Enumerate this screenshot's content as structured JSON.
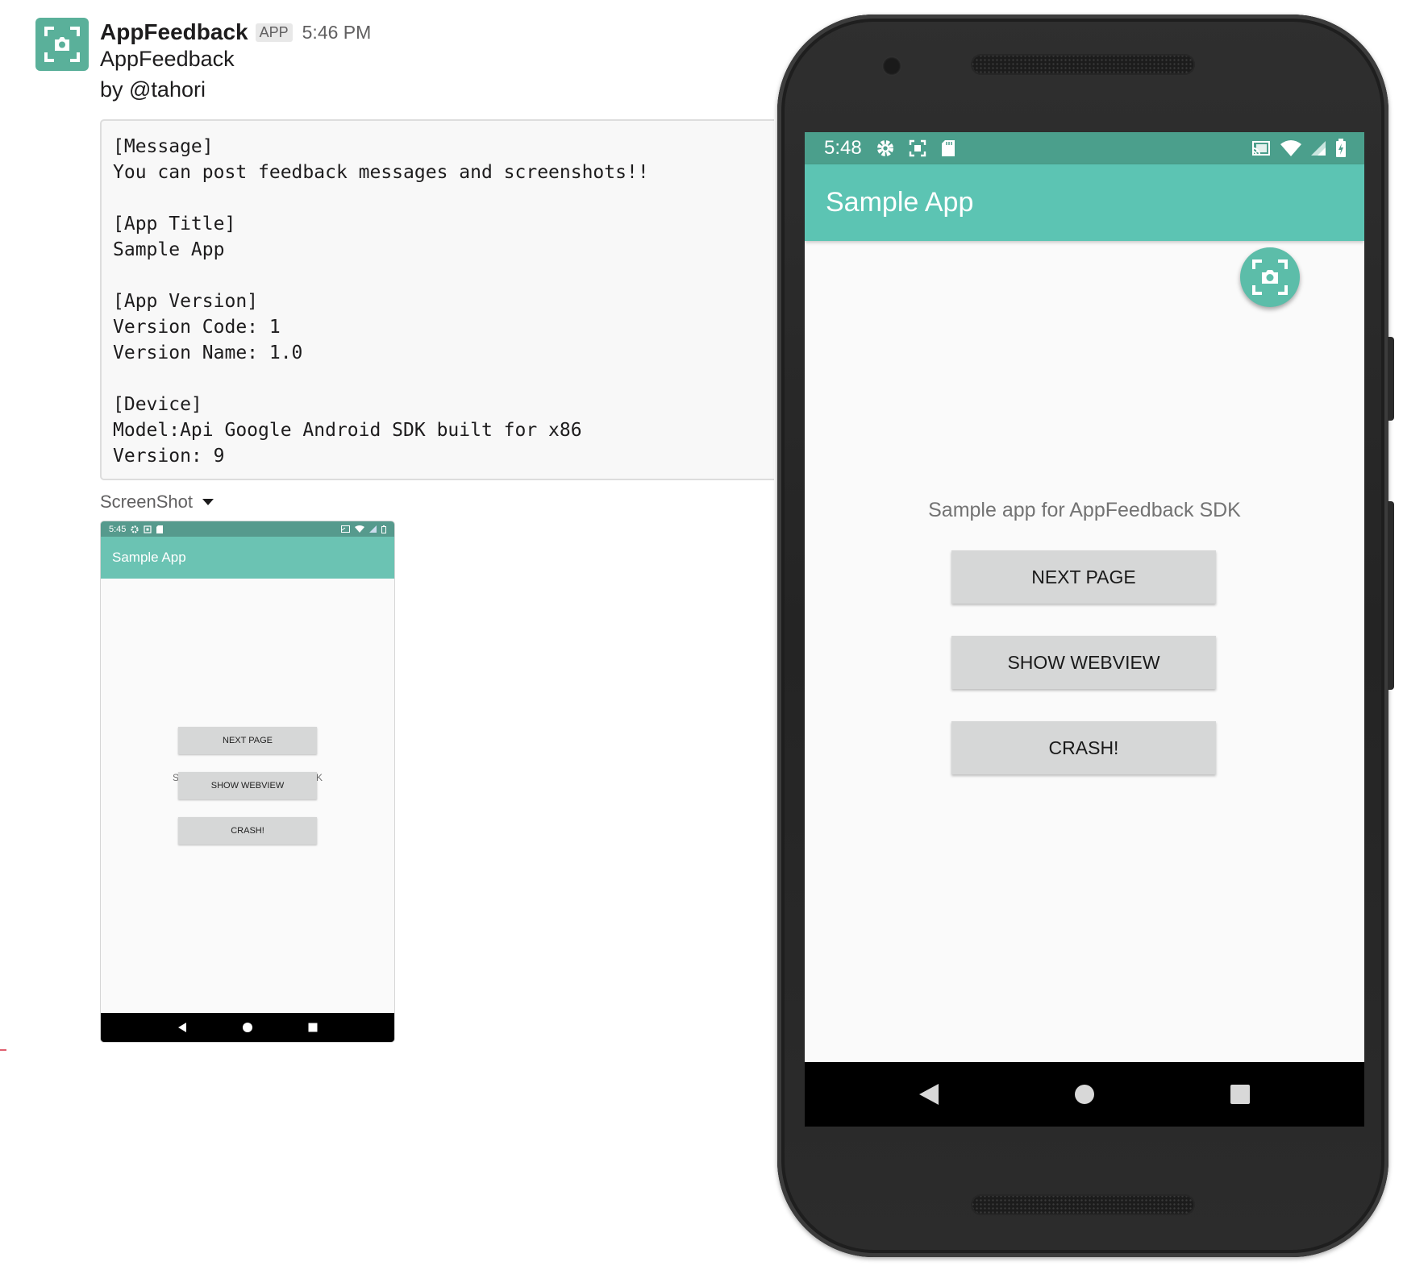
{
  "message": {
    "sender": "AppFeedback",
    "badge": "APP",
    "time": "5:46 PM",
    "line1": "AppFeedback",
    "line2": "by @tahori",
    "code_block": "[Message]\nYou can post feedback messages and screenshots!!\n\n[App Title]\nSample App\n\n[App Version]\nVersion Code: 1\nVersion Name: 1.0\n\n[Device]\nModel:Api Google Android SDK built for x86\nVersion: 9",
    "attachment_title": "ScreenShot"
  },
  "thumbnail": {
    "status_time": "5:45",
    "app_title": "Sample App",
    "body_text": "Sample app for AppFeedback SDK",
    "buttons": [
      "NEXT PAGE",
      "SHOW WEBVIEW",
      "CRASH!"
    ]
  },
  "phone": {
    "status_time": "5:48",
    "app_title": "Sample App",
    "body_text": "Sample app for AppFeedback SDK",
    "buttons": [
      "NEXT PAGE",
      "SHOW WEBVIEW",
      "CRASH!"
    ],
    "status_icons_left": [
      "settings-icon",
      "screenshot-icon",
      "sd-card-icon"
    ],
    "status_icons_right": [
      "cast-icon",
      "wifi-icon",
      "signal-icon",
      "battery-icon"
    ],
    "nav_icons": [
      "back-icon",
      "home-icon",
      "recents-icon"
    ]
  },
  "colors": {
    "accent": "#5cc4b3",
    "status_bar": "#4b9f8c",
    "avatar": "#5ab09a"
  }
}
